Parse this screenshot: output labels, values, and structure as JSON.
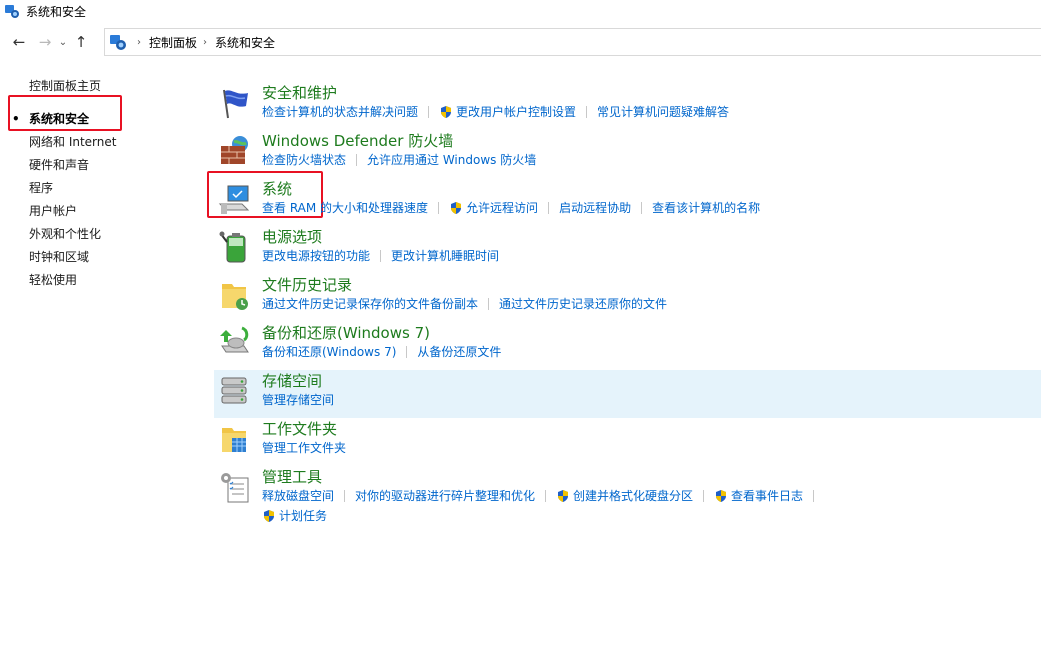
{
  "window": {
    "title": "系统和安全"
  },
  "nav": {
    "back": "←",
    "forward": "→",
    "recent": "⌄",
    "up": "↑"
  },
  "address": {
    "breadcrumbs": [
      "控制面板",
      "系统和安全"
    ]
  },
  "sidebar": {
    "home": "控制面板主页",
    "items": [
      "系统和安全",
      "网络和 Internet",
      "硬件和声音",
      "程序",
      "用户帐户",
      "外观和个性化",
      "时钟和区域",
      "轻松使用"
    ],
    "active_bullet": "•"
  },
  "categories": [
    {
      "title": "安全和维护",
      "links": [
        "检查计算机的状态并解决问题",
        "更改用户帐户控制设置",
        "常见计算机问题疑难解答"
      ]
    },
    {
      "title": "Windows Defender 防火墙",
      "links": [
        "检查防火墙状态",
        "允许应用通过 Windows 防火墙"
      ]
    },
    {
      "title": "系统",
      "links": [
        "查看 RAM 的大小和处理器速度",
        "允许远程访问",
        "启动远程协助",
        "查看该计算机的名称"
      ]
    },
    {
      "title": "电源选项",
      "links": [
        "更改电源按钮的功能",
        "更改计算机睡眠时间"
      ]
    },
    {
      "title": "文件历史记录",
      "links": [
        "通过文件历史记录保存你的文件备份副本",
        "通过文件历史记录还原你的文件"
      ]
    },
    {
      "title": "备份和还原(Windows 7)",
      "links": [
        "备份和还原(Windows 7)",
        "从备份还原文件"
      ]
    },
    {
      "title": "存储空间",
      "links": [
        "管理存储空间"
      ]
    },
    {
      "title": "工作文件夹",
      "links": [
        "管理工作文件夹"
      ]
    },
    {
      "title": "管理工具",
      "links": [
        "释放磁盘空间",
        "对你的驱动器进行碎片整理和优化",
        "创建并格式化硬盘分区",
        "查看事件日志",
        "计划任务"
      ]
    }
  ],
  "colors": {
    "link": "#0066cc",
    "category_title": "#1e7b1e",
    "highlight": "#e81123",
    "hover_row": "#e5f3fb"
  }
}
